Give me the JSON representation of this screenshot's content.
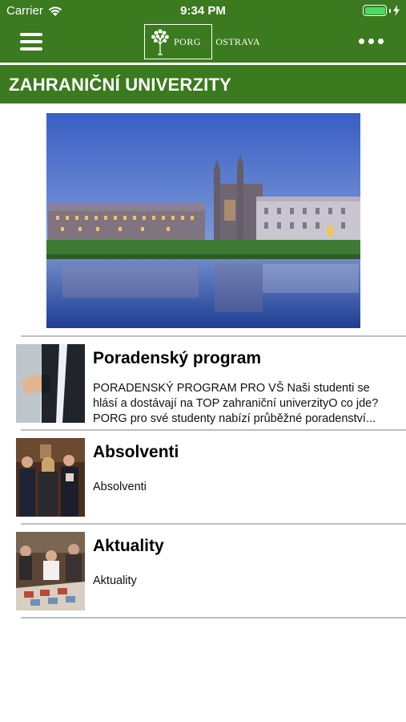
{
  "status_bar": {
    "carrier": "Carrier",
    "time": "9:34 PM"
  },
  "nav": {
    "logo_left": "PORG",
    "logo_right": "OSTRAVA"
  },
  "page_title": "ZAHRANIČNÍ UNIVERZITY",
  "items": [
    {
      "title": "Poradenský program",
      "description": "PORADENSKÝ PROGRAM PRO VŠ  Naši studenti se hlásí a dostávají na TOP zahraniční univerzityO co jde?PORG pro své studenty nabízí průběžné poradenství..."
    },
    {
      "title": "Absolventi",
      "description": "Absolventi"
    },
    {
      "title": "Aktuality",
      "description": "Aktuality"
    }
  ],
  "colors": {
    "brand_green": "#3b7a1e",
    "battery_green": "#4cd964",
    "separator": "#bfbfbf"
  }
}
